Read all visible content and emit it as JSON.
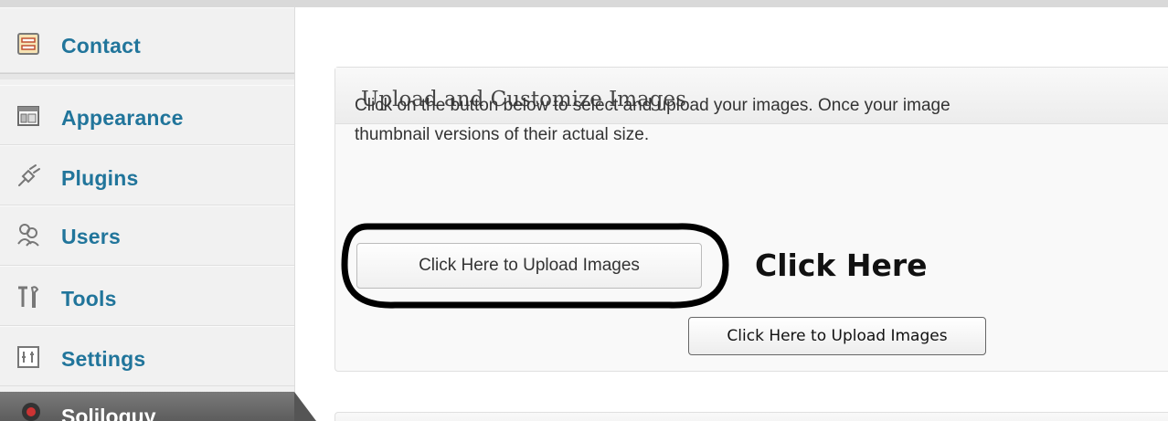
{
  "sidebar": {
    "items": [
      {
        "label": "Contact",
        "icon": "contact-form-icon"
      },
      {
        "label": "Appearance",
        "icon": "appearance-icon"
      },
      {
        "label": "Plugins",
        "icon": "plugins-icon"
      },
      {
        "label": "Users",
        "icon": "users-icon"
      },
      {
        "label": "Tools",
        "icon": "tools-icon"
      },
      {
        "label": "Settings",
        "icon": "settings-icon"
      }
    ],
    "active_item": {
      "label": "Soliloquy",
      "icon": "soliloquy-icon"
    }
  },
  "main": {
    "box_title": "Upload and Customize Images",
    "description_line1": "Click on the button below to select and upload your images. Once your image",
    "description_line2": "thumbnail versions of their actual size.",
    "upload_button_label": "Click Here to Upload Images",
    "annotation_label": "Click Here",
    "tooltip_button_label": "Click Here to Upload Images"
  },
  "colors": {
    "link_blue": "#21759b",
    "sidebar_bg": "#f1f1f1",
    "active_bg": "#555555",
    "annotation": "#000000"
  }
}
